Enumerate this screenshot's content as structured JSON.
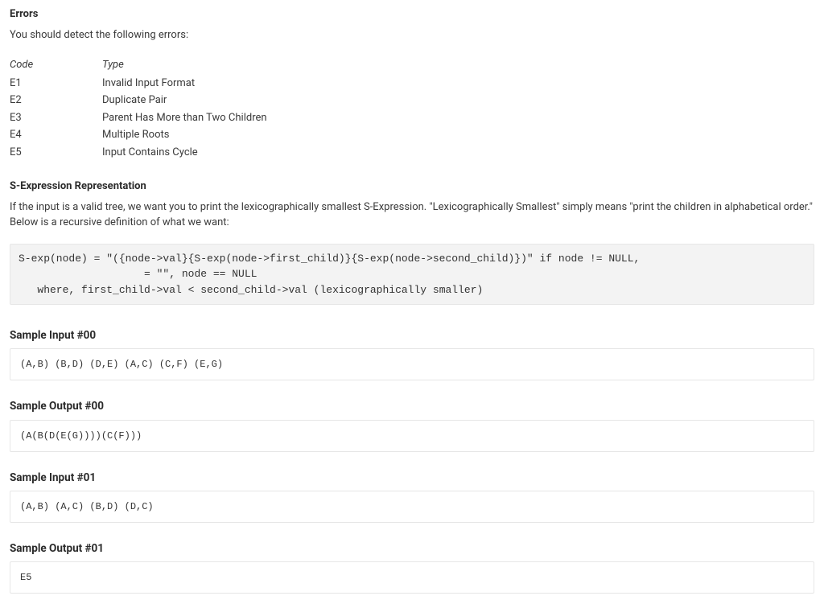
{
  "errors": {
    "heading": "Errors",
    "intro": "You should detect the following errors:",
    "col_code": "Code",
    "col_type": "Type",
    "rows": [
      {
        "code": "E1",
        "type": "Invalid Input Format"
      },
      {
        "code": "E2",
        "type": "Duplicate Pair"
      },
      {
        "code": "E3",
        "type": "Parent Has More than Two Children"
      },
      {
        "code": "E4",
        "type": "Multiple Roots"
      },
      {
        "code": "E5",
        "type": "Input Contains Cycle"
      }
    ]
  },
  "sexp": {
    "heading": "S-Expression Representation",
    "intro": "If the input is a valid tree, we want you to print the lexicographically smallest S-Expression. \"Lexicographically Smallest\" simply means \"print the children in alphabetical order.\" Below is a recursive definition of what we want:",
    "definition": "S-exp(node) = \"({node->val}{S-exp(node->first_child)}{S-exp(node->second_child)})\" if node != NULL,\n                    = \"\", node == NULL\n   where, first_child->val < second_child->val (lexicographically smaller)"
  },
  "samples": [
    {
      "heading": "Sample Input #00",
      "content": "(A,B) (B,D) (D,E) (A,C) (C,F) (E,G)"
    },
    {
      "heading": "Sample Output #00",
      "content": "(A(B(D(E(G))))(C(F)))"
    },
    {
      "heading": "Sample Input #01",
      "content": "(A,B) (A,C) (B,D) (D,C)"
    },
    {
      "heading": "Sample Output #01",
      "content": "E5"
    }
  ]
}
